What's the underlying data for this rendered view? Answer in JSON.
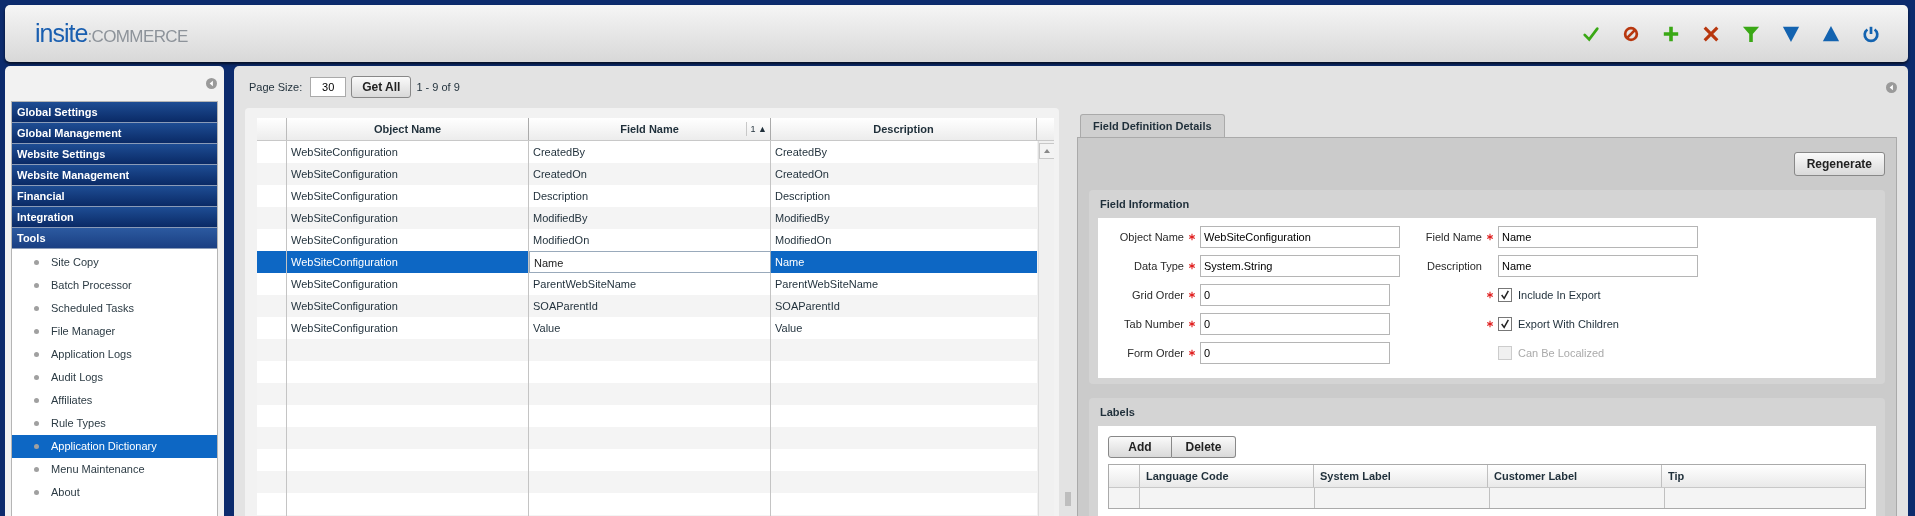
{
  "header": {
    "logo": {
      "brand": "insite",
      "separator": ":",
      "product": "COMMERCE"
    },
    "toolbar": [
      {
        "kind": "check"
      },
      {
        "kind": "cancel"
      },
      {
        "kind": "add"
      },
      {
        "kind": "delete"
      },
      {
        "kind": "filter"
      },
      {
        "kind": "down"
      },
      {
        "kind": "up"
      },
      {
        "kind": "power"
      }
    ]
  },
  "sidebar": {
    "sections": [
      {
        "label": "Global Settings",
        "expanded": false
      },
      {
        "label": "Global Management",
        "expanded": false
      },
      {
        "label": "Website Settings",
        "expanded": false
      },
      {
        "label": "Website Management",
        "expanded": false
      },
      {
        "label": "Financial",
        "expanded": false
      },
      {
        "label": "Integration",
        "expanded": false
      },
      {
        "label": "Tools",
        "expanded": true,
        "children": [
          {
            "label": "Site Copy",
            "selected": false
          },
          {
            "label": "Batch Processor",
            "selected": false
          },
          {
            "label": "Scheduled Tasks",
            "selected": false
          },
          {
            "label": "File Manager",
            "selected": false
          },
          {
            "label": "Application Logs",
            "selected": false
          },
          {
            "label": "Audit Logs",
            "selected": false
          },
          {
            "label": "Affiliates",
            "selected": false
          },
          {
            "label": "Rule Types",
            "selected": false
          },
          {
            "label": "Application Dictionary",
            "selected": true
          },
          {
            "label": "Menu Maintenance",
            "selected": false
          },
          {
            "label": "About",
            "selected": false
          }
        ]
      }
    ]
  },
  "pager": {
    "label": "Page Size:",
    "page_size": "30",
    "button": "Get All",
    "range": "1 - 9 of 9"
  },
  "grid": {
    "columns": [
      {
        "label": "Object Name"
      },
      {
        "label": "Field Name",
        "sort_order": "1",
        "sort_arrow": "▲"
      },
      {
        "label": "Description"
      }
    ],
    "rows": [
      {
        "cells": [
          "WebSiteConfiguration",
          "CreatedBy",
          "CreatedBy"
        ],
        "selected": false
      },
      {
        "cells": [
          "WebSiteConfiguration",
          "CreatedOn",
          "CreatedOn"
        ],
        "selected": false
      },
      {
        "cells": [
          "WebSiteConfiguration",
          "Description",
          "Description"
        ],
        "selected": false
      },
      {
        "cells": [
          "WebSiteConfiguration",
          "ModifiedBy",
          "ModifiedBy"
        ],
        "selected": false
      },
      {
        "cells": [
          "WebSiteConfiguration",
          "ModifiedOn",
          "ModifiedOn"
        ],
        "selected": false
      },
      {
        "cells": [
          "WebSiteConfiguration",
          "Name",
          "Name"
        ],
        "selected": true
      },
      {
        "cells": [
          "WebSiteConfiguration",
          "ParentWebSiteName",
          "ParentWebSiteName"
        ],
        "selected": false
      },
      {
        "cells": [
          "WebSiteConfiguration",
          "SOAParentId",
          "SOAParentId"
        ],
        "selected": false
      },
      {
        "cells": [
          "WebSiteConfiguration",
          "Value",
          "Value"
        ],
        "selected": false
      }
    ]
  },
  "details": {
    "tabs": [
      {
        "label": "Field Definition Details",
        "selected": true
      }
    ],
    "regenerate_button": "Regenerate",
    "field_information": {
      "title": "Field Information",
      "left_fields": [
        {
          "kind": "text",
          "label": "Object Name",
          "required": true,
          "value": "WebSiteConfiguration"
        },
        {
          "kind": "text",
          "label": "Data Type",
          "required": true,
          "value": "System.String"
        },
        {
          "kind": "number",
          "label": "Grid Order",
          "required": true,
          "value": "0"
        },
        {
          "kind": "number",
          "label": "Tab Number",
          "required": true,
          "value": "0"
        },
        {
          "kind": "number",
          "label": "Form Order",
          "required": true,
          "value": "0"
        }
      ],
      "right_fields": [
        {
          "kind": "text",
          "label": "Field Name",
          "required": true,
          "value": "Name"
        },
        {
          "kind": "text",
          "label": "Description",
          "required": false,
          "value": "Name"
        },
        {
          "kind": "checkbox",
          "label": "Include In Export",
          "required": true,
          "checked": true,
          "disabled": false
        },
        {
          "kind": "checkbox",
          "label": "Export With Children",
          "required": true,
          "checked": true,
          "disabled": false
        },
        {
          "kind": "checkbox",
          "label": "Can Be Localized",
          "required": false,
          "checked": false,
          "disabled": true
        }
      ]
    },
    "labels": {
      "title": "Labels",
      "buttons": [
        "Add",
        "Delete"
      ],
      "columns": [
        "Language Code",
        "System Label",
        "Customer Label",
        "Tip"
      ]
    }
  }
}
